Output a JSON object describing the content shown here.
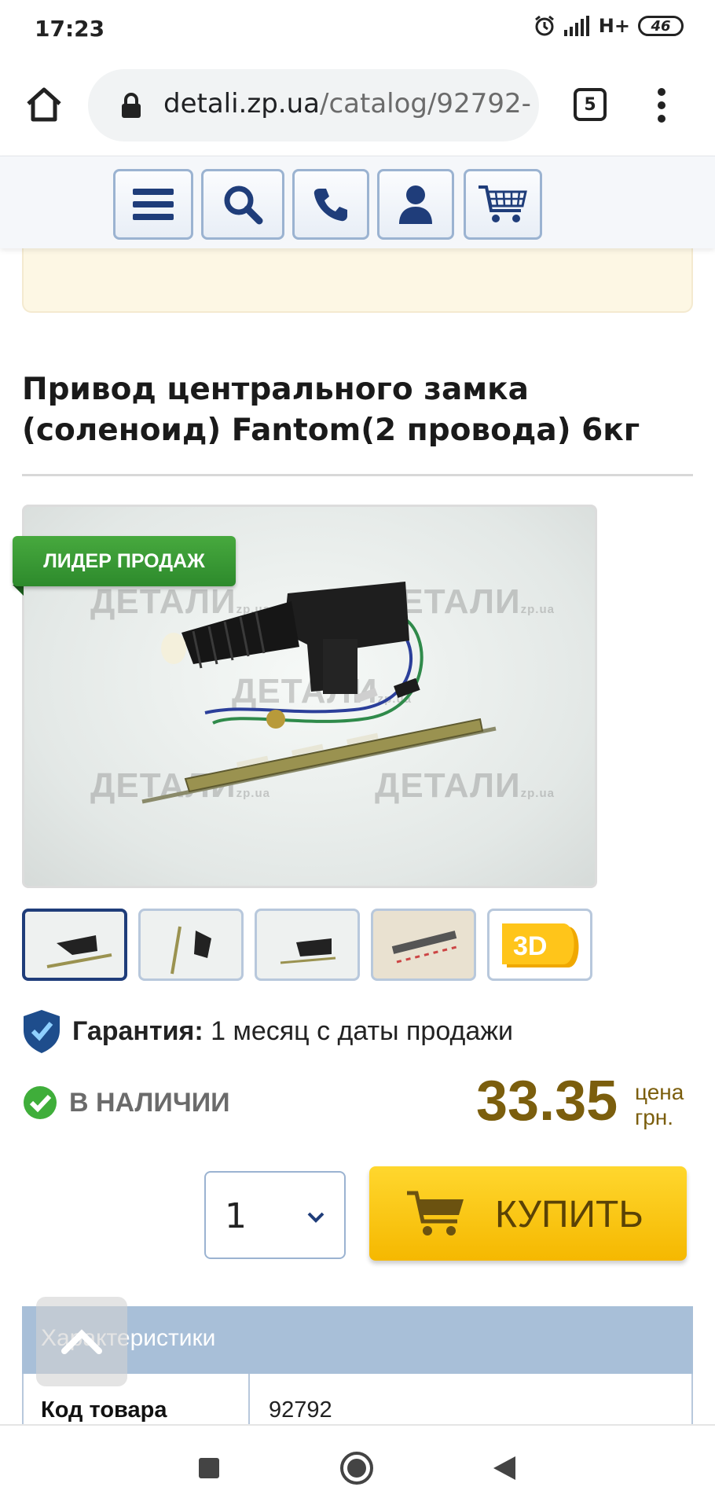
{
  "status_bar": {
    "time": "17:23",
    "network": "H+",
    "battery": "46",
    "icons": [
      "alarm-icon",
      "signal-icon",
      "battery-icon"
    ]
  },
  "browser": {
    "url_domain": "detali.zp.ua",
    "url_path": "/catalog/92792-",
    "tab_count": "5"
  },
  "toolbar": {
    "buttons": [
      "menu-icon",
      "search-icon",
      "phone-icon",
      "user-icon",
      "cart-icon"
    ],
    "accent_color": "#1f3d7a"
  },
  "product": {
    "title": "Привод центрального замка (соленоид) Fantom(2 провода) 6кг",
    "badge": "ЛИДЕР ПРОДАЖ",
    "watermark": "ДЕТАЛИ",
    "watermark_domain": "zp.ua",
    "thumbnails": [
      "photo-1",
      "photo-2",
      "photo-3",
      "photo-4",
      "3d-view"
    ],
    "thumb_3d_label": "3D",
    "warranty_label": "Гарантия:",
    "warranty_value": " 1 месяц с даты продажи",
    "stock_status": "В НАЛИЧИИ",
    "price": "33.35",
    "price_label_1": "цена",
    "price_label_2": "грн.",
    "quantity": "1",
    "buy_label": "КУПИТЬ"
  },
  "characteristics": {
    "header": "Характеристики",
    "rows": [
      {
        "key": "Код товара",
        "value": "92792"
      }
    ]
  },
  "colors": {
    "price": "#7b5e0d",
    "buy_button": "#f5b800",
    "badge": "#3a9a34",
    "table_header": "#a8bfd8"
  }
}
